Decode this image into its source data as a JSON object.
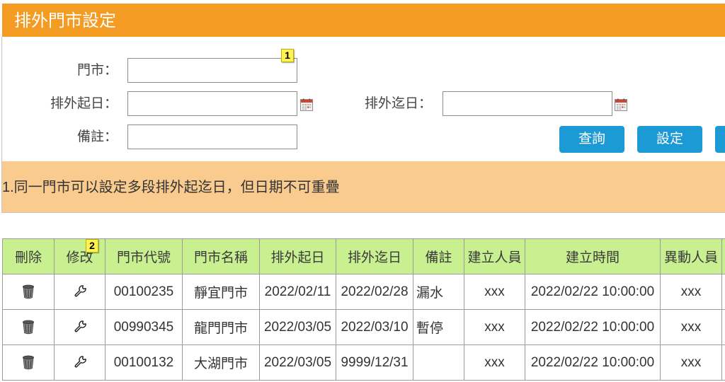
{
  "header": {
    "title": "排外門市設定"
  },
  "form": {
    "store": {
      "label": "門市：",
      "value": ""
    },
    "start_date": {
      "label": "排外起日：",
      "value": ""
    },
    "end_date": {
      "label": "排外迄日：",
      "value": ""
    },
    "note": {
      "label": "備註：",
      "value": ""
    },
    "query_button": "查詢",
    "set_button": "設定"
  },
  "badges": [
    "1",
    "2"
  ],
  "notice": {
    "text": "1.同一門市可以設定多段排外起迄日，但日期不可重疊"
  },
  "table": {
    "headers": [
      "刪除",
      "修改",
      "門市代號",
      "門市名稱",
      "排外起日",
      "排外迄日",
      "備註",
      "建立人員",
      "建立時間",
      "異動人員"
    ],
    "rows": [
      {
        "store_code": "00100235",
        "store_name": "靜宜門市",
        "start_date": "2022/02/11",
        "end_date": "2022/02/28",
        "note": "漏水",
        "created_by": "xxx",
        "created_at": "2022/02/22 10:00:00",
        "modified_by": "xxx"
      },
      {
        "store_code": "00990345",
        "store_name": "龍門門市",
        "start_date": "2022/03/05",
        "end_date": "2022/03/10",
        "note": "暫停",
        "created_by": "xxx",
        "created_at": "2022/02/22 10:00:00",
        "modified_by": "xxx"
      },
      {
        "store_code": "00100132",
        "store_name": "大湖門市",
        "start_date": "2022/03/05",
        "end_date": "9999/12/31",
        "note": "",
        "created_by": "xxx",
        "created_at": "2022/02/22 10:00:00",
        "modified_by": "xxx"
      }
    ],
    "row_icons": {
      "delete": "trash-icon",
      "edit": "wrench-icon"
    }
  },
  "icons": {
    "date_picker": "calendar-icon"
  },
  "colors": {
    "header_bg": "#F39B22",
    "notice_bg": "#F9CB8F",
    "table_header_bg": "#C8EF90",
    "button_bg": "#1B9AD6",
    "badge_bg": "#FFF44F",
    "border": "#9B9B9B"
  }
}
